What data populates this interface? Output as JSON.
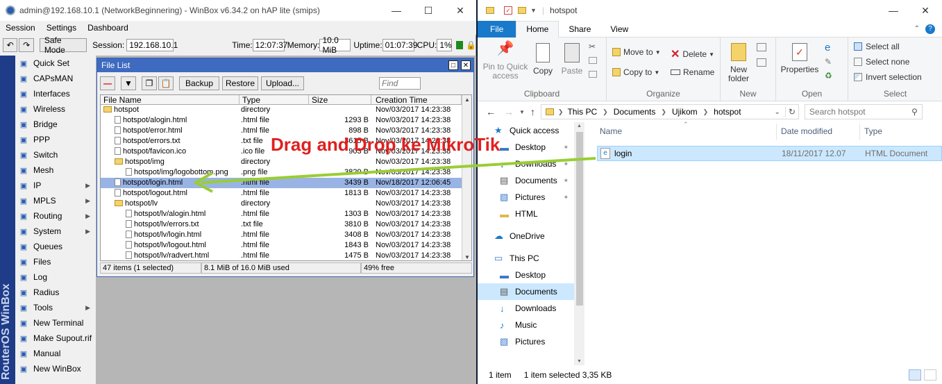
{
  "winbox": {
    "title": "admin@192.168.10.1 (NetworkBeginnering) - WinBox v6.34.2 on hAP lite (smips)",
    "menu": [
      "Session",
      "Settings",
      "Dashboard"
    ],
    "toolbar": {
      "safe_mode": "Safe Mode",
      "session_label": "Session:",
      "session_value": "192.168.10.1",
      "time_label": "Time:",
      "time_value": "12:07:37",
      "memory_label": "Memory:",
      "memory_value": "10.0 MiB",
      "uptime_label": "Uptime:",
      "uptime_value": "01:07:39",
      "cpu_label": "CPU:",
      "cpu_value": "1%"
    },
    "vertical_brand": "RouterOS WinBox",
    "sidebar": [
      {
        "label": "Quick Set",
        "arrow": false,
        "icon": "quick-set-icon"
      },
      {
        "label": "CAPsMAN",
        "arrow": false,
        "icon": "capsman-icon"
      },
      {
        "label": "Interfaces",
        "arrow": false,
        "icon": "interfaces-icon"
      },
      {
        "label": "Wireless",
        "arrow": false,
        "icon": "wireless-icon"
      },
      {
        "label": "Bridge",
        "arrow": false,
        "icon": "bridge-icon"
      },
      {
        "label": "PPP",
        "arrow": false,
        "icon": "ppp-icon"
      },
      {
        "label": "Switch",
        "arrow": false,
        "icon": "switch-icon"
      },
      {
        "label": "Mesh",
        "arrow": false,
        "icon": "mesh-icon"
      },
      {
        "label": "IP",
        "arrow": true,
        "icon": "ip-icon"
      },
      {
        "label": "MPLS",
        "arrow": true,
        "icon": "mpls-icon"
      },
      {
        "label": "Routing",
        "arrow": true,
        "icon": "routing-icon"
      },
      {
        "label": "System",
        "arrow": true,
        "icon": "system-icon"
      },
      {
        "label": "Queues",
        "arrow": false,
        "icon": "queues-icon"
      },
      {
        "label": "Files",
        "arrow": false,
        "icon": "files-icon"
      },
      {
        "label": "Log",
        "arrow": false,
        "icon": "log-icon"
      },
      {
        "label": "Radius",
        "arrow": false,
        "icon": "radius-icon"
      },
      {
        "label": "Tools",
        "arrow": true,
        "icon": "tools-icon"
      },
      {
        "label": "New Terminal",
        "arrow": false,
        "icon": "terminal-icon"
      },
      {
        "label": "Make Supout.rif",
        "arrow": false,
        "icon": "supout-icon"
      },
      {
        "label": "Manual",
        "arrow": false,
        "icon": "manual-icon"
      },
      {
        "label": "New WinBox",
        "arrow": false,
        "icon": "winbox-icon"
      }
    ],
    "file_list": {
      "title": "File List",
      "buttons": {
        "backup": "Backup",
        "restore": "Restore",
        "upload": "Upload..."
      },
      "find_placeholder": "Find",
      "columns": [
        "File Name",
        "Type",
        "Size",
        "Creation Time"
      ],
      "rows": [
        {
          "name": "hotspot",
          "type": "directory",
          "size": "",
          "time": "Nov/03/2017 14:23:38",
          "indent": 0,
          "folder": true,
          "selected": false
        },
        {
          "name": "hotspot/alogin.html",
          "type": ".html file",
          "size": "1293 B",
          "time": "Nov/03/2017 14:23:38",
          "indent": 1,
          "folder": false,
          "selected": false
        },
        {
          "name": "hotspot/error.html",
          "type": ".html file",
          "size": "898 B",
          "time": "Nov/03/2017 14:23:38",
          "indent": 1,
          "folder": false,
          "selected": false
        },
        {
          "name": "hotspot/errors.txt",
          "type": ".txt file",
          "size": "3615 B",
          "time": "Nov/03/2017 14:23:38",
          "indent": 1,
          "folder": false,
          "selected": false
        },
        {
          "name": "hotspot/favicon.ico",
          "type": ".ico file",
          "size": "903 B",
          "time": "Nov/03/2017 14:23:38",
          "indent": 1,
          "folder": false,
          "selected": false
        },
        {
          "name": "hotspot/img",
          "type": "directory",
          "size": "",
          "time": "Nov/03/2017 14:23:38",
          "indent": 1,
          "folder": true,
          "selected": false
        },
        {
          "name": "hotspot/img/logobottom.png",
          "type": ".png file",
          "size": "3829 B",
          "time": "Nov/03/2017 14:23:38",
          "indent": 2,
          "folder": false,
          "selected": false
        },
        {
          "name": "hotspot/login.html",
          "type": ".html file",
          "size": "3439 B",
          "time": "Nov/18/2017 12:06:45",
          "indent": 1,
          "folder": false,
          "selected": true
        },
        {
          "name": "hotspot/logout.html",
          "type": ".html file",
          "size": "1813 B",
          "time": "Nov/03/2017 14:23:38",
          "indent": 1,
          "folder": false,
          "selected": false
        },
        {
          "name": "hotspot/lv",
          "type": "directory",
          "size": "",
          "time": "Nov/03/2017 14:23:38",
          "indent": 1,
          "folder": true,
          "selected": false
        },
        {
          "name": "hotspot/lv/alogin.html",
          "type": ".html file",
          "size": "1303 B",
          "time": "Nov/03/2017 14:23:38",
          "indent": 2,
          "folder": false,
          "selected": false
        },
        {
          "name": "hotspot/lv/errors.txt",
          "type": ".txt file",
          "size": "3810 B",
          "time": "Nov/03/2017 14:23:38",
          "indent": 2,
          "folder": false,
          "selected": false
        },
        {
          "name": "hotspot/lv/login.html",
          "type": ".html file",
          "size": "3408 B",
          "time": "Nov/03/2017 14:23:38",
          "indent": 2,
          "folder": false,
          "selected": false
        },
        {
          "name": "hotspot/lv/logout.html",
          "type": ".html file",
          "size": "1843 B",
          "time": "Nov/03/2017 14:23:38",
          "indent": 2,
          "folder": false,
          "selected": false
        },
        {
          "name": "hotspot/lv/radvert.html",
          "type": ".html file",
          "size": "1475 B",
          "time": "Nov/03/2017 14:23:38",
          "indent": 2,
          "folder": false,
          "selected": false
        }
      ],
      "status": {
        "count": "47 items (1 selected)",
        "used": "8.1 MiB of 16.0 MiB used",
        "free": "49% free"
      }
    }
  },
  "annotation": {
    "text": "Drag and Drop ke MikroTik",
    "color": "#e02020",
    "arrow_color": "#9acd32"
  },
  "explorer": {
    "title": "hotspot",
    "tabs": [
      "File",
      "Home",
      "Share",
      "View"
    ],
    "ribbon": {
      "clipboard": {
        "pin": "Pin to Quick access",
        "copy": "Copy",
        "paste": "Paste",
        "group": "Clipboard"
      },
      "organize": {
        "move_to": "Move to",
        "copy_to": "Copy to",
        "delete": "Delete",
        "rename": "Rename",
        "group": "Organize"
      },
      "new": {
        "new_folder": "New folder",
        "group": "New"
      },
      "open": {
        "properties": "Properties",
        "group": "Open"
      },
      "select": {
        "select_all": "Select all",
        "select_none": "Select none",
        "invert": "Invert selection",
        "group": "Select"
      }
    },
    "breadcrumb": [
      "This PC",
      "Documents",
      "Ujikom",
      "hotspot"
    ],
    "search_placeholder": "Search hotspot",
    "nav": [
      {
        "label": "Quick access",
        "icon": "star-icon",
        "pinned": false,
        "indent": 0,
        "selected": false
      },
      {
        "label": "Desktop",
        "icon": "desktop-icon",
        "pinned": true,
        "indent": 1,
        "selected": false
      },
      {
        "label": "Downloads",
        "icon": "download-icon",
        "pinned": true,
        "indent": 1,
        "selected": false
      },
      {
        "label": "Documents",
        "icon": "documents-icon",
        "pinned": true,
        "indent": 1,
        "selected": false
      },
      {
        "label": "Pictures",
        "icon": "pictures-icon",
        "pinned": true,
        "indent": 1,
        "selected": false
      },
      {
        "label": "HTML",
        "icon": "folder-icon",
        "pinned": false,
        "indent": 1,
        "selected": false
      },
      {
        "label": "OneDrive",
        "icon": "onedrive-icon",
        "pinned": false,
        "indent": 0,
        "selected": false,
        "gap": true
      },
      {
        "label": "This PC",
        "icon": "pc-icon",
        "pinned": false,
        "indent": 0,
        "selected": false,
        "gap": true
      },
      {
        "label": "Desktop",
        "icon": "desktop-icon",
        "pinned": false,
        "indent": 1,
        "selected": false
      },
      {
        "label": "Documents",
        "icon": "documents-icon",
        "pinned": false,
        "indent": 1,
        "selected": true
      },
      {
        "label": "Downloads",
        "icon": "download-icon",
        "pinned": false,
        "indent": 1,
        "selected": false
      },
      {
        "label": "Music",
        "icon": "music-icon",
        "pinned": false,
        "indent": 1,
        "selected": false
      },
      {
        "label": "Pictures",
        "icon": "pictures-icon",
        "pinned": false,
        "indent": 1,
        "selected": false
      }
    ],
    "columns": [
      "Name",
      "Date modified",
      "Type"
    ],
    "files": [
      {
        "name": "login",
        "date": "18/11/2017 12.07",
        "type": "HTML Document",
        "selected": true
      }
    ],
    "status": {
      "items": "1 item",
      "selected": "1 item selected  3,35 KB"
    }
  }
}
